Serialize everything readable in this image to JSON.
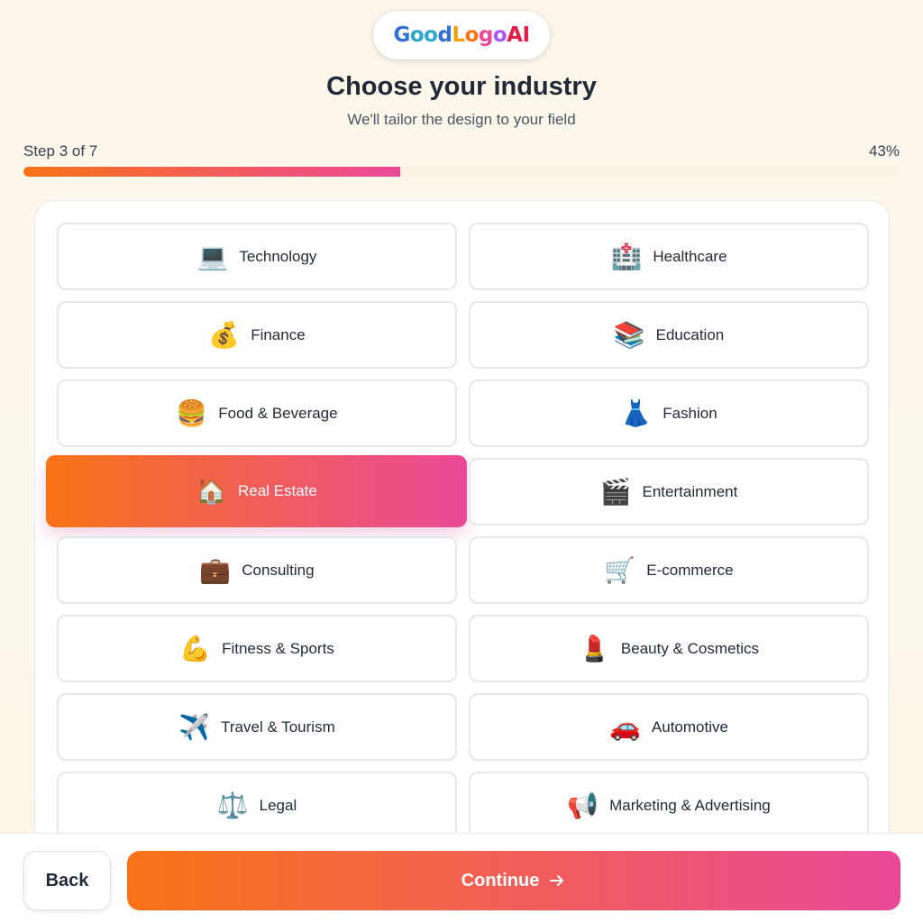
{
  "logo": {
    "parts": [
      "G",
      "oo",
      "d",
      "L",
      "o",
      "g",
      "o",
      "AI"
    ]
  },
  "header": {
    "title": "Choose your industry",
    "subtitle": "We'll tailor the design to your field"
  },
  "progress": {
    "step_label": "Step 3 of 7",
    "percent_label": "43%",
    "percent": 43
  },
  "industries": [
    {
      "label": "Technology",
      "emoji": "💻",
      "selected": false
    },
    {
      "label": "Healthcare",
      "emoji": "🏥",
      "selected": false
    },
    {
      "label": "Finance",
      "emoji": "💰",
      "selected": false
    },
    {
      "label": "Education",
      "emoji": "📚",
      "selected": false
    },
    {
      "label": "Food & Beverage",
      "emoji": "🍔",
      "selected": false
    },
    {
      "label": "Fashion",
      "emoji": "👗",
      "selected": false
    },
    {
      "label": "Real Estate",
      "emoji": "🏠",
      "selected": true
    },
    {
      "label": "Entertainment",
      "emoji": "🎬",
      "selected": false
    },
    {
      "label": "Consulting",
      "emoji": "💼",
      "selected": false
    },
    {
      "label": "E-commerce",
      "emoji": "🛒",
      "selected": false
    },
    {
      "label": "Fitness & Sports",
      "emoji": "💪",
      "selected": false
    },
    {
      "label": "Beauty & Cosmetics",
      "emoji": "💄",
      "selected": false
    },
    {
      "label": "Travel & Tourism",
      "emoji": "✈️",
      "selected": false
    },
    {
      "label": "Automotive",
      "emoji": "🚗",
      "selected": false
    },
    {
      "label": "Legal",
      "emoji": "⚖️",
      "selected": false
    },
    {
      "label": "Marketing & Advertising",
      "emoji": "📢",
      "selected": false
    }
  ],
  "footer": {
    "back_label": "Back",
    "continue_label": "Continue"
  },
  "colors": {
    "accent_start": "#f97316",
    "accent_end": "#ec4899"
  }
}
